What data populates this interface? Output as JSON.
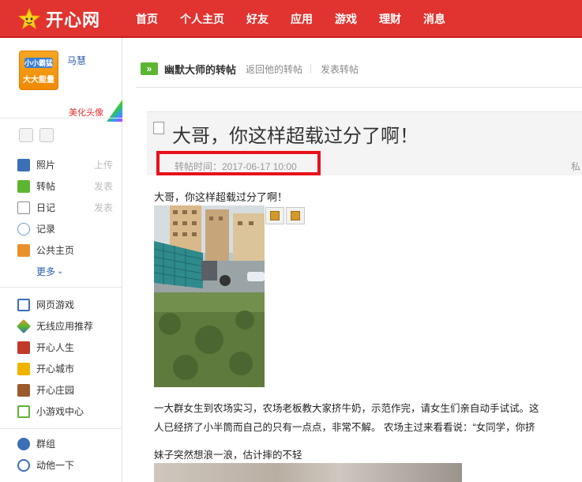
{
  "header": {
    "logo_text": "开心网",
    "nav": [
      "首页",
      "个人主页",
      "好友",
      "应用",
      "游戏",
      "理财",
      "消息"
    ]
  },
  "sidebar": {
    "avatar_text_top": "小小霸猛",
    "avatar_text_bottom": "大大能量",
    "username": "马慧",
    "beautify_label": "美化头像",
    "menu_group_1": [
      {
        "label": "照片",
        "action": "上传",
        "icon": "photo-icon",
        "color": "#3b6fb6"
      },
      {
        "label": "转帖",
        "action": "发表",
        "icon": "repost-icon",
        "color": "#5cb531"
      },
      {
        "label": "日记",
        "action": "发表",
        "icon": "diary-icon",
        "color": "#8a8a8a"
      },
      {
        "label": "记录",
        "action": "",
        "icon": "record-icon",
        "color": "#6aa0d8"
      },
      {
        "label": "公共主页",
        "action": "",
        "icon": "flag-icon",
        "color": "#e8902a"
      }
    ],
    "more_label": "更多",
    "menu_group_2": [
      {
        "label": "网页游戏",
        "icon": "web-game-icon",
        "color": "#3b6fb6"
      },
      {
        "label": "无线应用推荐",
        "icon": "mobile-app-icon",
        "color": "#e8902a"
      },
      {
        "label": "开心人生",
        "icon": "life-icon",
        "color": "#c0392b"
      },
      {
        "label": "开心城市",
        "icon": "city-icon",
        "color": "#f0b400"
      },
      {
        "label": "开心庄园",
        "icon": "farm-icon",
        "color": "#9b5a2b"
      },
      {
        "label": "小游戏中心",
        "icon": "mini-game-icon",
        "color": "#5cb531"
      }
    ],
    "menu_group_3": [
      {
        "label": "群组",
        "icon": "group-icon",
        "color": "#3b6fb6"
      },
      {
        "label": "动他一下",
        "icon": "poke-icon",
        "color": "#3b6fb6"
      }
    ]
  },
  "breadcrumb": {
    "title": "幽默大师的转帖",
    "link_back": "返回他的转帖",
    "link_post": "发表转帖"
  },
  "post": {
    "title": "大哥，你这样超载过分了啊！",
    "time": "转帖时间：2017-06-17 10:00",
    "private": "私",
    "intro": "大哥，你这样超载过分了啊！",
    "paragraph_line1": "一大群女生到农场实习，农场老板教大家挤牛奶，示范作完，请女生们亲自动手试试。这",
    "paragraph_line2": "人已经挤了小半筒而自己的只有一点点，非常不解。 农场主过来看看说：“女同学，你挤",
    "caption2": "妹子突然想浪一浪，估计摔的不轻"
  },
  "colors": {
    "brand_red": "#e1332f",
    "link_blue": "#2a5caa",
    "highlight_box": "#e8121a"
  }
}
